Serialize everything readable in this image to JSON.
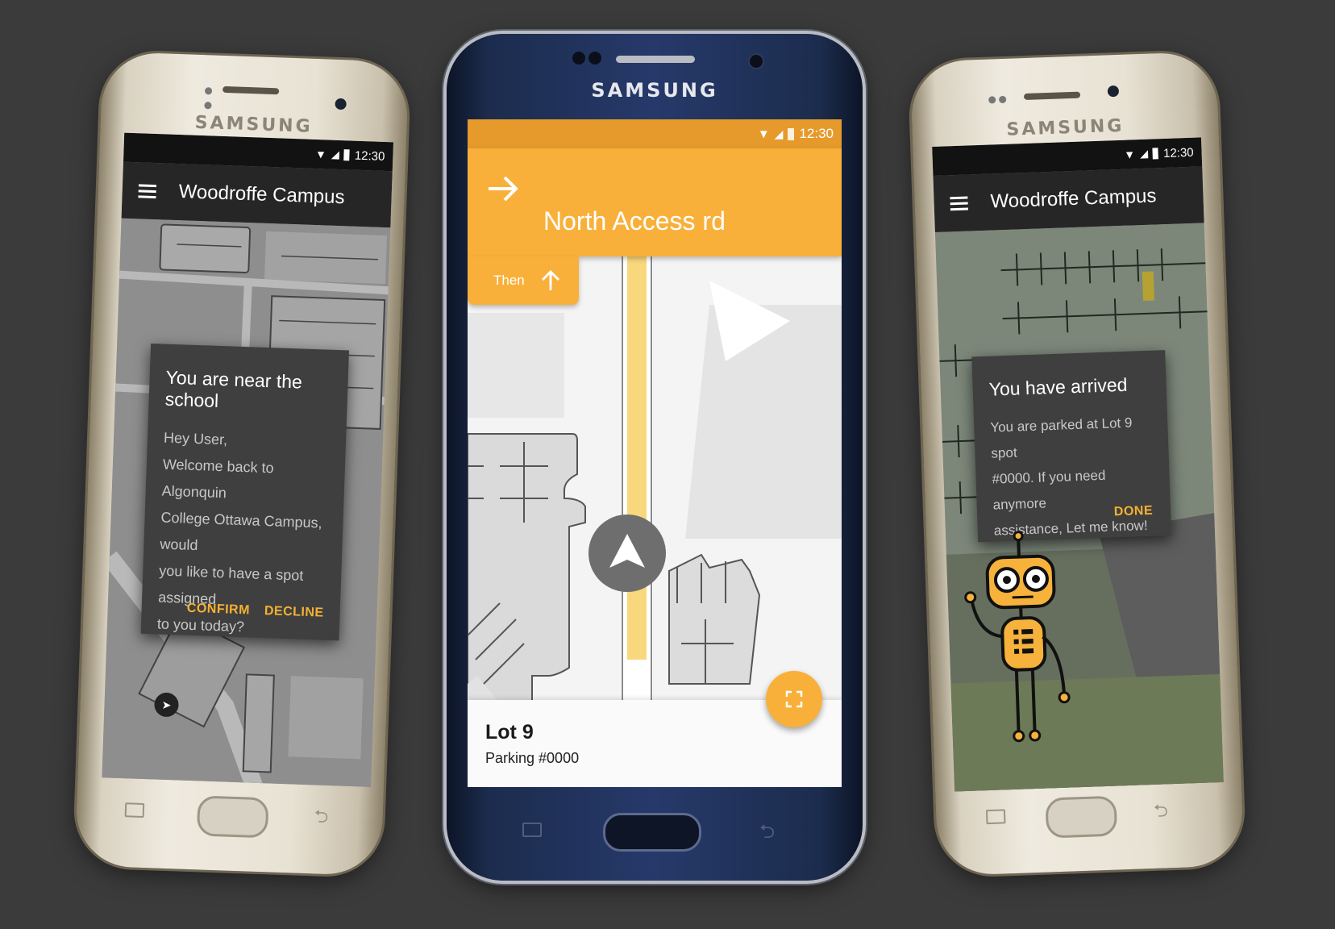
{
  "background_color": "#3b3b3b",
  "accent_color": "#f9b03a",
  "left_phone": {
    "brand": "SAMSUNG",
    "status": {
      "time": "12:30"
    },
    "appbar": {
      "menu_icon": "hamburger-icon",
      "title": "Woodroffe Campus"
    },
    "dialog": {
      "title": "You are near the school",
      "body_lines": [
        "Hey User,",
        "Welcome back to Algonquin",
        "College Ottawa Campus, would",
        "you like to have a spot assigned",
        "to you today?"
      ],
      "confirm_label": "CONFIRM",
      "decline_label": "DECLINE"
    },
    "location_icon": "navigation-arrow-icon"
  },
  "center_phone": {
    "brand": "SAMSUNG",
    "status": {
      "time": "12:30"
    },
    "nav": {
      "turn_icon": "arrow-right-icon",
      "street": "North Access rd"
    },
    "then": {
      "label": "Then",
      "icon": "arrow-up-icon"
    },
    "bottom": {
      "title": "Lot 9",
      "subtitle": "Parking #0000"
    },
    "fab_icon": "fullscreen-icon",
    "location_icon": "navigation-arrow-icon"
  },
  "right_phone": {
    "brand": "SAMSUNG",
    "status": {
      "time": "12:30"
    },
    "appbar": {
      "menu_icon": "hamburger-icon",
      "title": "Woodroffe Campus"
    },
    "dialog": {
      "title": "You have arrived",
      "body_lines": [
        "You are parked at Lot 9 spot",
        "#0000. If you need anymore",
        "assistance, Let me know!"
      ],
      "done_label": "DONE"
    },
    "mascot": "robot-mascot"
  }
}
